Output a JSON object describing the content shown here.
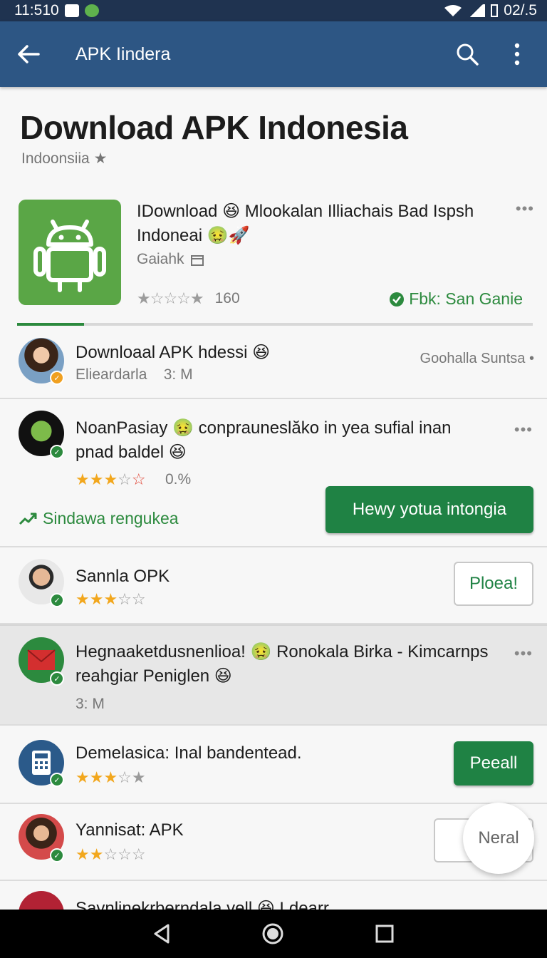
{
  "status_bar": {
    "time": "11:510",
    "right_text": "02/.5"
  },
  "app_bar": {
    "title": "APK Iindera"
  },
  "header": {
    "title": "Download APK Indonesia",
    "subtitle": "Indoonsiia ★"
  },
  "featured": {
    "title": "IDownload 😆 Mlookalan Illiachais Bad Ispsh Indoneai 🤢🚀",
    "developer": "Gaiahk",
    "rating_count": "160",
    "tag": "Fbk: San Ganie",
    "more": "•••",
    "download_progress": 0.13,
    "icon": "android-icon",
    "accent": "#2c8a3e"
  },
  "rows": [
    {
      "title": "Downloaal APK hdessi 😆",
      "meta_author": "Elieardarla",
      "meta_time": "3: M",
      "side": "Goohalla Suntsa •"
    },
    {
      "title": "NoanPasiay 🤢 conprauneslăko in yea sufial inan pnad baldel 😆",
      "rating_text": "0.%",
      "link": "Sindawa rengukea",
      "button": "Hewy yotua intongia",
      "more": "•••"
    },
    {
      "title": "Sannla OPK",
      "button": "Ploea!"
    },
    {
      "title": "Hegnaaketdusnenlioa! 🤢 Ronokala Birka - Kimcarnps reahgiar Peniglen 😆",
      "meta_time": "3: M",
      "more": "•••"
    },
    {
      "title": "Demelasica: Inal bandentead.",
      "button": "Peeall"
    },
    {
      "title": "Yannisat: APK"
    },
    {
      "title": "Savnlinekrberndala vell 😆 Ldearr"
    }
  ],
  "fab": {
    "label": "Neral"
  },
  "colors": {
    "appbar": "#2d5684",
    "statusbar": "#1f3350",
    "primary_green": "#1f8244",
    "star": "#f2a71d"
  }
}
